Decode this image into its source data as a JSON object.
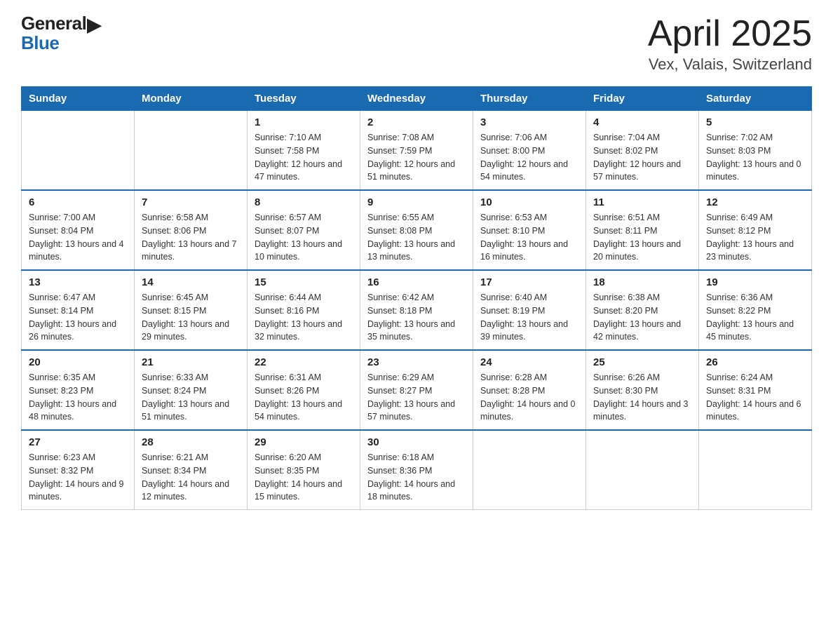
{
  "header": {
    "logo_general": "General",
    "logo_blue": "Blue",
    "title": "April 2025",
    "subtitle": "Vex, Valais, Switzerland"
  },
  "columns": [
    "Sunday",
    "Monday",
    "Tuesday",
    "Wednesday",
    "Thursday",
    "Friday",
    "Saturday"
  ],
  "weeks": [
    [
      {
        "day": "",
        "sunrise": "",
        "sunset": "",
        "daylight": ""
      },
      {
        "day": "",
        "sunrise": "",
        "sunset": "",
        "daylight": ""
      },
      {
        "day": "1",
        "sunrise": "Sunrise: 7:10 AM",
        "sunset": "Sunset: 7:58 PM",
        "daylight": "Daylight: 12 hours and 47 minutes."
      },
      {
        "day": "2",
        "sunrise": "Sunrise: 7:08 AM",
        "sunset": "Sunset: 7:59 PM",
        "daylight": "Daylight: 12 hours and 51 minutes."
      },
      {
        "day": "3",
        "sunrise": "Sunrise: 7:06 AM",
        "sunset": "Sunset: 8:00 PM",
        "daylight": "Daylight: 12 hours and 54 minutes."
      },
      {
        "day": "4",
        "sunrise": "Sunrise: 7:04 AM",
        "sunset": "Sunset: 8:02 PM",
        "daylight": "Daylight: 12 hours and 57 minutes."
      },
      {
        "day": "5",
        "sunrise": "Sunrise: 7:02 AM",
        "sunset": "Sunset: 8:03 PM",
        "daylight": "Daylight: 13 hours and 0 minutes."
      }
    ],
    [
      {
        "day": "6",
        "sunrise": "Sunrise: 7:00 AM",
        "sunset": "Sunset: 8:04 PM",
        "daylight": "Daylight: 13 hours and 4 minutes."
      },
      {
        "day": "7",
        "sunrise": "Sunrise: 6:58 AM",
        "sunset": "Sunset: 8:06 PM",
        "daylight": "Daylight: 13 hours and 7 minutes."
      },
      {
        "day": "8",
        "sunrise": "Sunrise: 6:57 AM",
        "sunset": "Sunset: 8:07 PM",
        "daylight": "Daylight: 13 hours and 10 minutes."
      },
      {
        "day": "9",
        "sunrise": "Sunrise: 6:55 AM",
        "sunset": "Sunset: 8:08 PM",
        "daylight": "Daylight: 13 hours and 13 minutes."
      },
      {
        "day": "10",
        "sunrise": "Sunrise: 6:53 AM",
        "sunset": "Sunset: 8:10 PM",
        "daylight": "Daylight: 13 hours and 16 minutes."
      },
      {
        "day": "11",
        "sunrise": "Sunrise: 6:51 AM",
        "sunset": "Sunset: 8:11 PM",
        "daylight": "Daylight: 13 hours and 20 minutes."
      },
      {
        "day": "12",
        "sunrise": "Sunrise: 6:49 AM",
        "sunset": "Sunset: 8:12 PM",
        "daylight": "Daylight: 13 hours and 23 minutes."
      }
    ],
    [
      {
        "day": "13",
        "sunrise": "Sunrise: 6:47 AM",
        "sunset": "Sunset: 8:14 PM",
        "daylight": "Daylight: 13 hours and 26 minutes."
      },
      {
        "day": "14",
        "sunrise": "Sunrise: 6:45 AM",
        "sunset": "Sunset: 8:15 PM",
        "daylight": "Daylight: 13 hours and 29 minutes."
      },
      {
        "day": "15",
        "sunrise": "Sunrise: 6:44 AM",
        "sunset": "Sunset: 8:16 PM",
        "daylight": "Daylight: 13 hours and 32 minutes."
      },
      {
        "day": "16",
        "sunrise": "Sunrise: 6:42 AM",
        "sunset": "Sunset: 8:18 PM",
        "daylight": "Daylight: 13 hours and 35 minutes."
      },
      {
        "day": "17",
        "sunrise": "Sunrise: 6:40 AM",
        "sunset": "Sunset: 8:19 PM",
        "daylight": "Daylight: 13 hours and 39 minutes."
      },
      {
        "day": "18",
        "sunrise": "Sunrise: 6:38 AM",
        "sunset": "Sunset: 8:20 PM",
        "daylight": "Daylight: 13 hours and 42 minutes."
      },
      {
        "day": "19",
        "sunrise": "Sunrise: 6:36 AM",
        "sunset": "Sunset: 8:22 PM",
        "daylight": "Daylight: 13 hours and 45 minutes."
      }
    ],
    [
      {
        "day": "20",
        "sunrise": "Sunrise: 6:35 AM",
        "sunset": "Sunset: 8:23 PM",
        "daylight": "Daylight: 13 hours and 48 minutes."
      },
      {
        "day": "21",
        "sunrise": "Sunrise: 6:33 AM",
        "sunset": "Sunset: 8:24 PM",
        "daylight": "Daylight: 13 hours and 51 minutes."
      },
      {
        "day": "22",
        "sunrise": "Sunrise: 6:31 AM",
        "sunset": "Sunset: 8:26 PM",
        "daylight": "Daylight: 13 hours and 54 minutes."
      },
      {
        "day": "23",
        "sunrise": "Sunrise: 6:29 AM",
        "sunset": "Sunset: 8:27 PM",
        "daylight": "Daylight: 13 hours and 57 minutes."
      },
      {
        "day": "24",
        "sunrise": "Sunrise: 6:28 AM",
        "sunset": "Sunset: 8:28 PM",
        "daylight": "Daylight: 14 hours and 0 minutes."
      },
      {
        "day": "25",
        "sunrise": "Sunrise: 6:26 AM",
        "sunset": "Sunset: 8:30 PM",
        "daylight": "Daylight: 14 hours and 3 minutes."
      },
      {
        "day": "26",
        "sunrise": "Sunrise: 6:24 AM",
        "sunset": "Sunset: 8:31 PM",
        "daylight": "Daylight: 14 hours and 6 minutes."
      }
    ],
    [
      {
        "day": "27",
        "sunrise": "Sunrise: 6:23 AM",
        "sunset": "Sunset: 8:32 PM",
        "daylight": "Daylight: 14 hours and 9 minutes."
      },
      {
        "day": "28",
        "sunrise": "Sunrise: 6:21 AM",
        "sunset": "Sunset: 8:34 PM",
        "daylight": "Daylight: 14 hours and 12 minutes."
      },
      {
        "day": "29",
        "sunrise": "Sunrise: 6:20 AM",
        "sunset": "Sunset: 8:35 PM",
        "daylight": "Daylight: 14 hours and 15 minutes."
      },
      {
        "day": "30",
        "sunrise": "Sunrise: 6:18 AM",
        "sunset": "Sunset: 8:36 PM",
        "daylight": "Daylight: 14 hours and 18 minutes."
      },
      {
        "day": "",
        "sunrise": "",
        "sunset": "",
        "daylight": ""
      },
      {
        "day": "",
        "sunrise": "",
        "sunset": "",
        "daylight": ""
      },
      {
        "day": "",
        "sunrise": "",
        "sunset": "",
        "daylight": ""
      }
    ]
  ]
}
